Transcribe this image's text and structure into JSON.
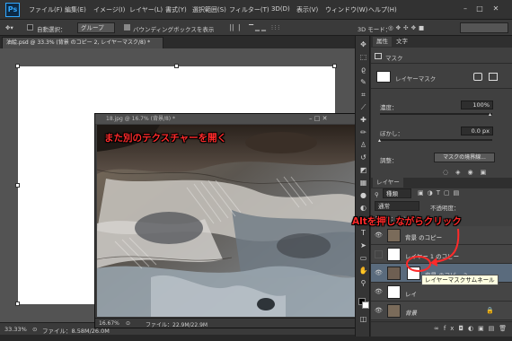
{
  "app": {
    "logo": "Ps"
  },
  "menu": [
    "ファイル(F)",
    "編集(E)",
    "イメージ(I)",
    "レイヤー(L)",
    "書式(Y)",
    "選択範囲(S)",
    "フィルター(T)",
    "3D(D)",
    "表示(V)",
    "ウィンドウ(W)",
    "ヘルプ(H)"
  ],
  "options": {
    "auto_select": "自動選択：",
    "group": "グループ",
    "bbox": "バウンディングボックスを表示",
    "mode3d": "3D モード："
  },
  "doc": {
    "tab": "油絵.psd @ 33.3% (背景 のコピー 2, レイヤーマスク/8) *",
    "zoom": "33.33%",
    "file_info": "ファイル：8.58M/26.0M"
  },
  "floatwin": {
    "title": "18.jpg @ 16.7% (背景/8) *",
    "zoom": "16.67%",
    "file_info": "ファイル：22.9M/22.9M"
  },
  "annotations": {
    "open_texture": "また別のテクスチャーを開く",
    "alt_click": "Altを押しながらクリック"
  },
  "properties": {
    "tab1": "属性",
    "tab2": "文字",
    "mask_label": "マスク",
    "layer_mask": "レイヤーマスク",
    "density_label": "濃度：",
    "density_value": "100%",
    "feather_label": "ぼかし：",
    "feather_value": "0.0 px",
    "adjust_label": "調整：",
    "mask_edge_button": "マスクの境界線..."
  },
  "layers": {
    "tab": "レイヤー",
    "filter": "種類",
    "blend": "通常",
    "opacity_label": "不透明度：",
    "rows": [
      {
        "name": "背景 のコピー",
        "eye": "👁"
      },
      {
        "name": "レイヤー 1 のコピー",
        "eye": ""
      },
      {
        "name": "背景 のコピー 2",
        "eye": "👁"
      },
      {
        "name": "レイ",
        "eye": "👁"
      },
      {
        "name": "背景",
        "eye": "👁"
      }
    ],
    "tooltip": "レイヤーマスクサムネール"
  },
  "colors": {
    "accent": "#31a8ff",
    "annotation": "#ff2a2a",
    "selected_row": "#5a6b7d"
  }
}
